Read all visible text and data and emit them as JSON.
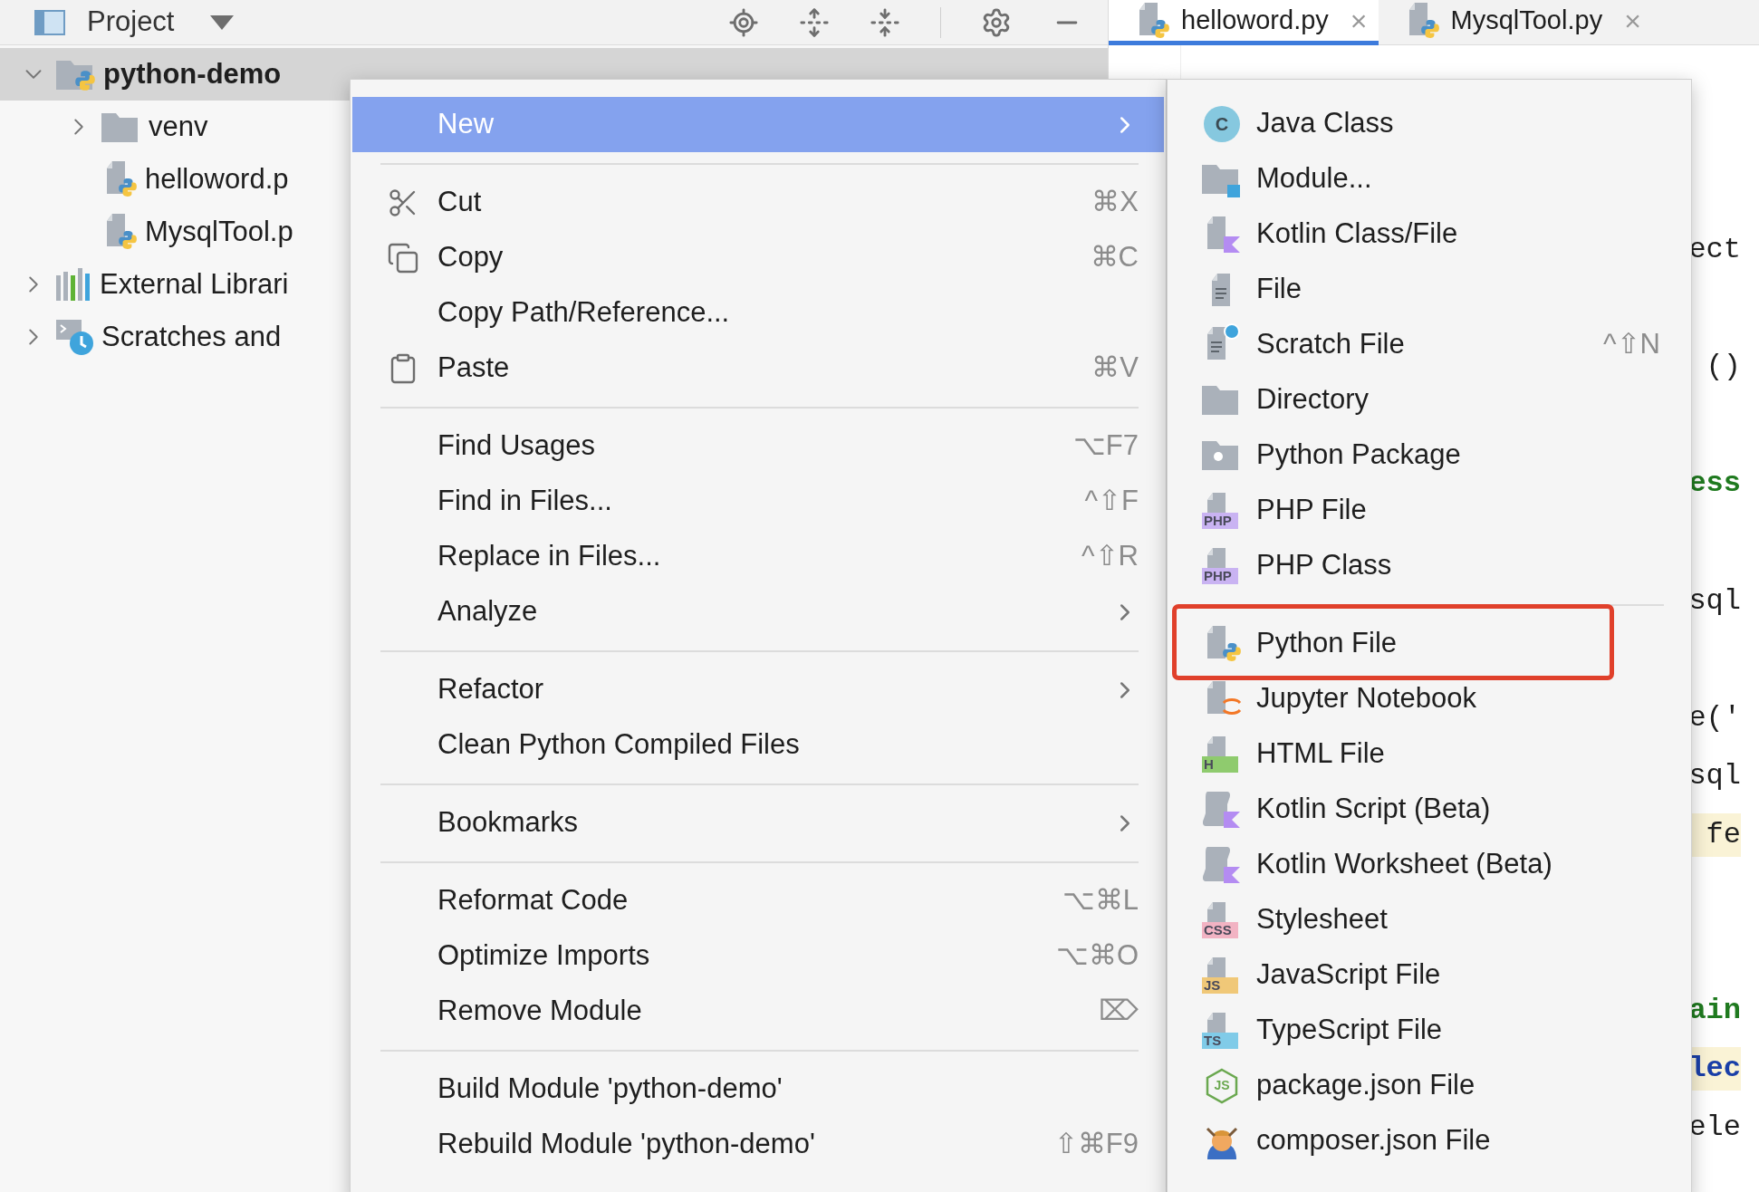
{
  "project_panel": {
    "title": "Project",
    "tree": [
      {
        "label": "python-demo",
        "kind": "project",
        "expanded": true,
        "selected": true,
        "children": [
          {
            "label": "venv",
            "kind": "folder",
            "expanded": false,
            "selected": false
          },
          {
            "label": "helloword.p",
            "kind": "python",
            "selected": false
          },
          {
            "label": "MysqlTool.p",
            "kind": "python",
            "selected": false
          }
        ]
      },
      {
        "label": "External Librari",
        "kind": "libraries",
        "expanded": false,
        "selected": false
      },
      {
        "label": "Scratches and",
        "kind": "scratches",
        "expanded": false,
        "selected": false
      }
    ]
  },
  "editor": {
    "tabs": [
      {
        "label": "helloword.py",
        "close": "×",
        "selected": true
      },
      {
        "label": "MysqlTool.py",
        "close": "×",
        "selected": false
      }
    ],
    "code_fragments": [
      {
        "text": "ect",
        "kind": "plain",
        "highlighted": false
      },
      {
        "text": "()",
        "kind": "plain",
        "highlighted": false
      },
      {
        "text": "ess",
        "kind": "string",
        "highlighted": false
      },
      {
        "text": "sql",
        "kind": "plain",
        "highlighted": false
      },
      {
        "text": "e('",
        "kind": "plain",
        "highlighted": false
      },
      {
        "text": "sql",
        "kind": "plain",
        "highlighted": false
      },
      {
        "text": " fe",
        "kind": "plain",
        "highlighted": true
      },
      {
        "text": "ain",
        "kind": "string",
        "highlighted": false
      },
      {
        "text": "lec",
        "kind": "call",
        "highlighted": true
      },
      {
        "text": "ele",
        "kind": "plain",
        "highlighted": false
      }
    ]
  },
  "context_menu": {
    "groups": [
      [
        {
          "label": "New",
          "kind": "text",
          "submenu": true,
          "selected": true
        }
      ],
      [
        {
          "label": "Cut",
          "kind": "cut",
          "shortcut": "⌘X",
          "submenu": false,
          "selected": false
        },
        {
          "label": "Copy",
          "kind": "copy",
          "shortcut": "⌘C",
          "submenu": false,
          "selected": false
        },
        {
          "label": "Copy Path/Reference...",
          "kind": "text",
          "submenu": false,
          "selected": false
        },
        {
          "label": "Paste",
          "kind": "paste",
          "shortcut": "⌘V",
          "submenu": false,
          "selected": false
        }
      ],
      [
        {
          "label": "Find Usages",
          "kind": "text",
          "shortcut": "⌥F7",
          "submenu": false,
          "selected": false
        },
        {
          "label": "Find in Files...",
          "kind": "text",
          "shortcut": "^⇧F",
          "submenu": false,
          "selected": false
        },
        {
          "label": "Replace in Files...",
          "kind": "text",
          "shortcut": "^⇧R",
          "submenu": false,
          "selected": false
        },
        {
          "label": "Analyze",
          "kind": "text",
          "submenu": true,
          "selected": false
        }
      ],
      [
        {
          "label": "Refactor",
          "kind": "text",
          "submenu": true,
          "selected": false
        },
        {
          "label": "Clean Python Compiled Files",
          "kind": "text",
          "submenu": false,
          "selected": false
        }
      ],
      [
        {
          "label": "Bookmarks",
          "kind": "text",
          "submenu": true,
          "selected": false
        }
      ],
      [
        {
          "label": "Reformat Code",
          "kind": "text",
          "shortcut": "⌥⌘L",
          "submenu": false,
          "selected": false
        },
        {
          "label": "Optimize Imports",
          "kind": "text",
          "shortcut": "⌥⌘O",
          "submenu": false,
          "selected": false
        },
        {
          "label": "Remove Module",
          "kind": "text",
          "shortcut": "⌦",
          "submenu": false,
          "selected": false
        }
      ],
      [
        {
          "label": "Build Module 'python-demo'",
          "kind": "text",
          "submenu": false,
          "selected": false
        },
        {
          "label": "Rebuild Module 'python-demo'",
          "kind": "text",
          "shortcut": "⇧⌘F9",
          "submenu": false,
          "selected": false
        }
      ]
    ]
  },
  "new_submenu": {
    "groups": [
      [
        {
          "label": "Java Class",
          "kind": "java",
          "badge": "C",
          "selected": false,
          "annotated": false
        },
        {
          "label": "Module...",
          "kind": "module",
          "selected": false,
          "annotated": false
        },
        {
          "label": "Kotlin Class/File",
          "kind": "kotlin",
          "selected": false,
          "annotated": false
        },
        {
          "label": "File",
          "kind": "file",
          "selected": false,
          "annotated": false
        },
        {
          "label": "Scratch File",
          "kind": "scratch",
          "shortcut": "^⇧N",
          "selected": false,
          "annotated": false
        },
        {
          "label": "Directory",
          "kind": "directory",
          "selected": false,
          "annotated": false
        },
        {
          "label": "Python Package",
          "kind": "package",
          "selected": false,
          "annotated": false
        },
        {
          "label": "PHP File",
          "kind": "badge",
          "badge": "PHP",
          "color": "#c9b3f2",
          "selected": false,
          "annotated": false
        },
        {
          "label": "PHP Class",
          "kind": "badge",
          "badge": "PHP",
          "color": "#c9b3f2",
          "selected": false,
          "annotated": false
        }
      ],
      [
        {
          "label": "Python File",
          "kind": "python",
          "selected": false,
          "annotated": true
        },
        {
          "label": "Jupyter Notebook",
          "kind": "jupyter",
          "selected": false,
          "annotated": false
        },
        {
          "label": "HTML File",
          "kind": "badge",
          "badge": "H",
          "color": "#8fcb6e",
          "selected": false,
          "annotated": false
        },
        {
          "label": "Kotlin Script (Beta)",
          "kind": "kotlin-script",
          "selected": false,
          "annotated": false
        },
        {
          "label": "Kotlin Worksheet (Beta)",
          "kind": "kotlin-script",
          "selected": false,
          "annotated": false
        },
        {
          "label": "Stylesheet",
          "kind": "badge",
          "badge": "CSS",
          "color": "#f2b3c3",
          "selected": false,
          "annotated": false
        },
        {
          "label": "JavaScript File",
          "kind": "badge",
          "badge": "JS",
          "color": "#f0c878",
          "selected": false,
          "annotated": false
        },
        {
          "label": "TypeScript File",
          "kind": "badge",
          "badge": "TS",
          "color": "#80cbe8",
          "selected": false,
          "annotated": false
        },
        {
          "label": "package.json File",
          "kind": "node",
          "badge": "JS",
          "selected": false,
          "annotated": false
        },
        {
          "label": "composer.json File",
          "kind": "composer",
          "selected": false,
          "annotated": false
        }
      ]
    ]
  }
}
